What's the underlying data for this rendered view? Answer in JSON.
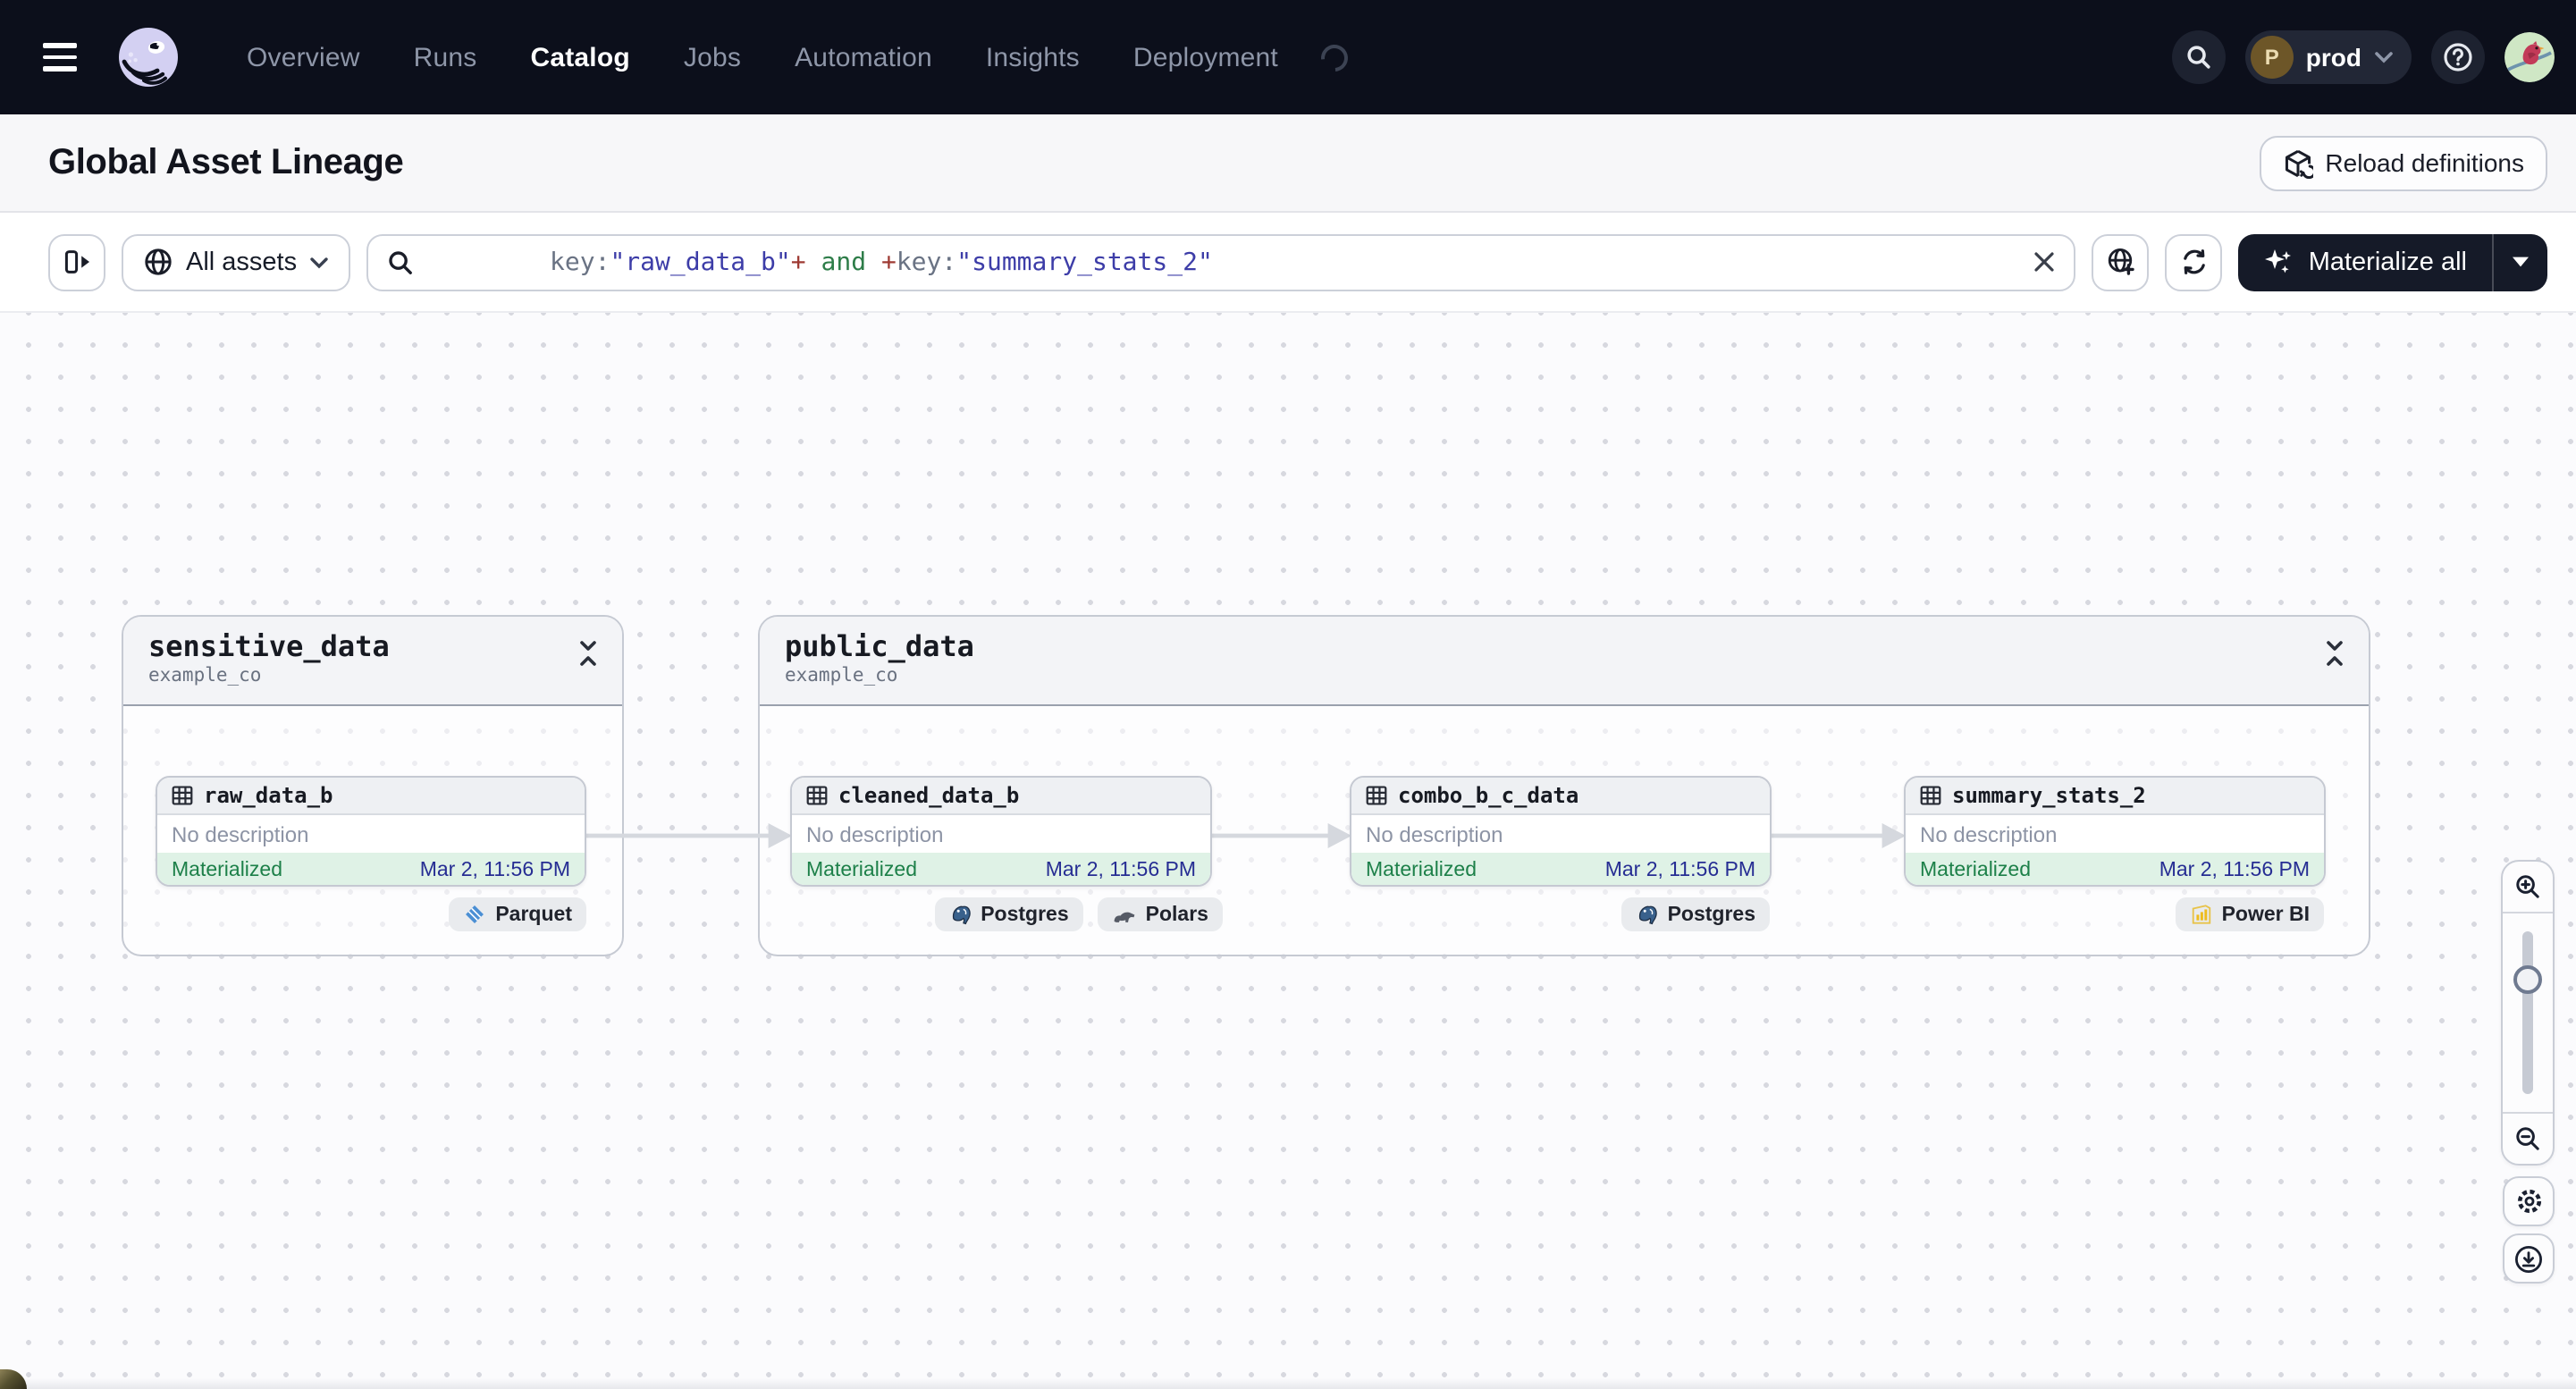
{
  "nav": {
    "menu": [
      {
        "label": "Overview"
      },
      {
        "label": "Runs"
      },
      {
        "label": "Catalog"
      },
      {
        "label": "Jobs"
      },
      {
        "label": "Automation"
      },
      {
        "label": "Insights"
      },
      {
        "label": "Deployment"
      }
    ],
    "active_item": "Catalog",
    "deployment": {
      "label": "prod",
      "initial": "P"
    }
  },
  "page_header": {
    "title": "Global Asset Lineage",
    "reload_button": "Reload definitions"
  },
  "toolbar": {
    "scope_button": "All assets",
    "materialize_button": "Materialize all",
    "query": {
      "segments": [
        {
          "text": "key:",
          "color": "#6a7384"
        },
        {
          "text": "\"raw_data_b\"",
          "color": "#3d3da8"
        },
        {
          "text": "+",
          "color": "#9e3a33"
        },
        {
          "text": " and ",
          "color": "#2e7d49"
        },
        {
          "text": "+",
          "color": "#9e3a33"
        },
        {
          "text": "key:",
          "color": "#6a7384"
        },
        {
          "text": "\"summary_stats_2\"",
          "color": "#3d3da8"
        }
      ]
    }
  },
  "graph": {
    "groups": [
      {
        "name": "sensitive_data",
        "owner": "example_co"
      },
      {
        "name": "public_data",
        "owner": "example_co"
      }
    ],
    "assets": [
      {
        "name": "raw_data_b",
        "description": "No description",
        "status": "Materialized",
        "materialized_at": "Mar 2, 11:56 PM",
        "tags": [
          {
            "label": "Parquet",
            "icon": "parquet-icon"
          }
        ]
      },
      {
        "name": "cleaned_data_b",
        "description": "No description",
        "status": "Materialized",
        "materialized_at": "Mar 2, 11:56 PM",
        "tags": [
          {
            "label": "Postgres",
            "icon": "postgres-icon"
          },
          {
            "label": "Polars",
            "icon": "polars-icon"
          }
        ]
      },
      {
        "name": "combo_b_c_data",
        "description": "No description",
        "status": "Materialized",
        "materialized_at": "Mar 2, 11:56 PM",
        "tags": [
          {
            "label": "Postgres",
            "icon": "postgres-icon"
          }
        ]
      },
      {
        "name": "summary_stats_2",
        "description": "No description",
        "status": "Materialized",
        "materialized_at": "Mar 2, 11:56 PM",
        "tags": [
          {
            "label": "Power BI",
            "icon": "powerbi-icon"
          }
        ]
      }
    ]
  },
  "colors": {
    "status_green": "#1d8049",
    "status_background": "#dff2e6",
    "timestamp_navy": "#262d93",
    "accent_dark": "#151a28",
    "navbar": "#0c0f1b"
  }
}
